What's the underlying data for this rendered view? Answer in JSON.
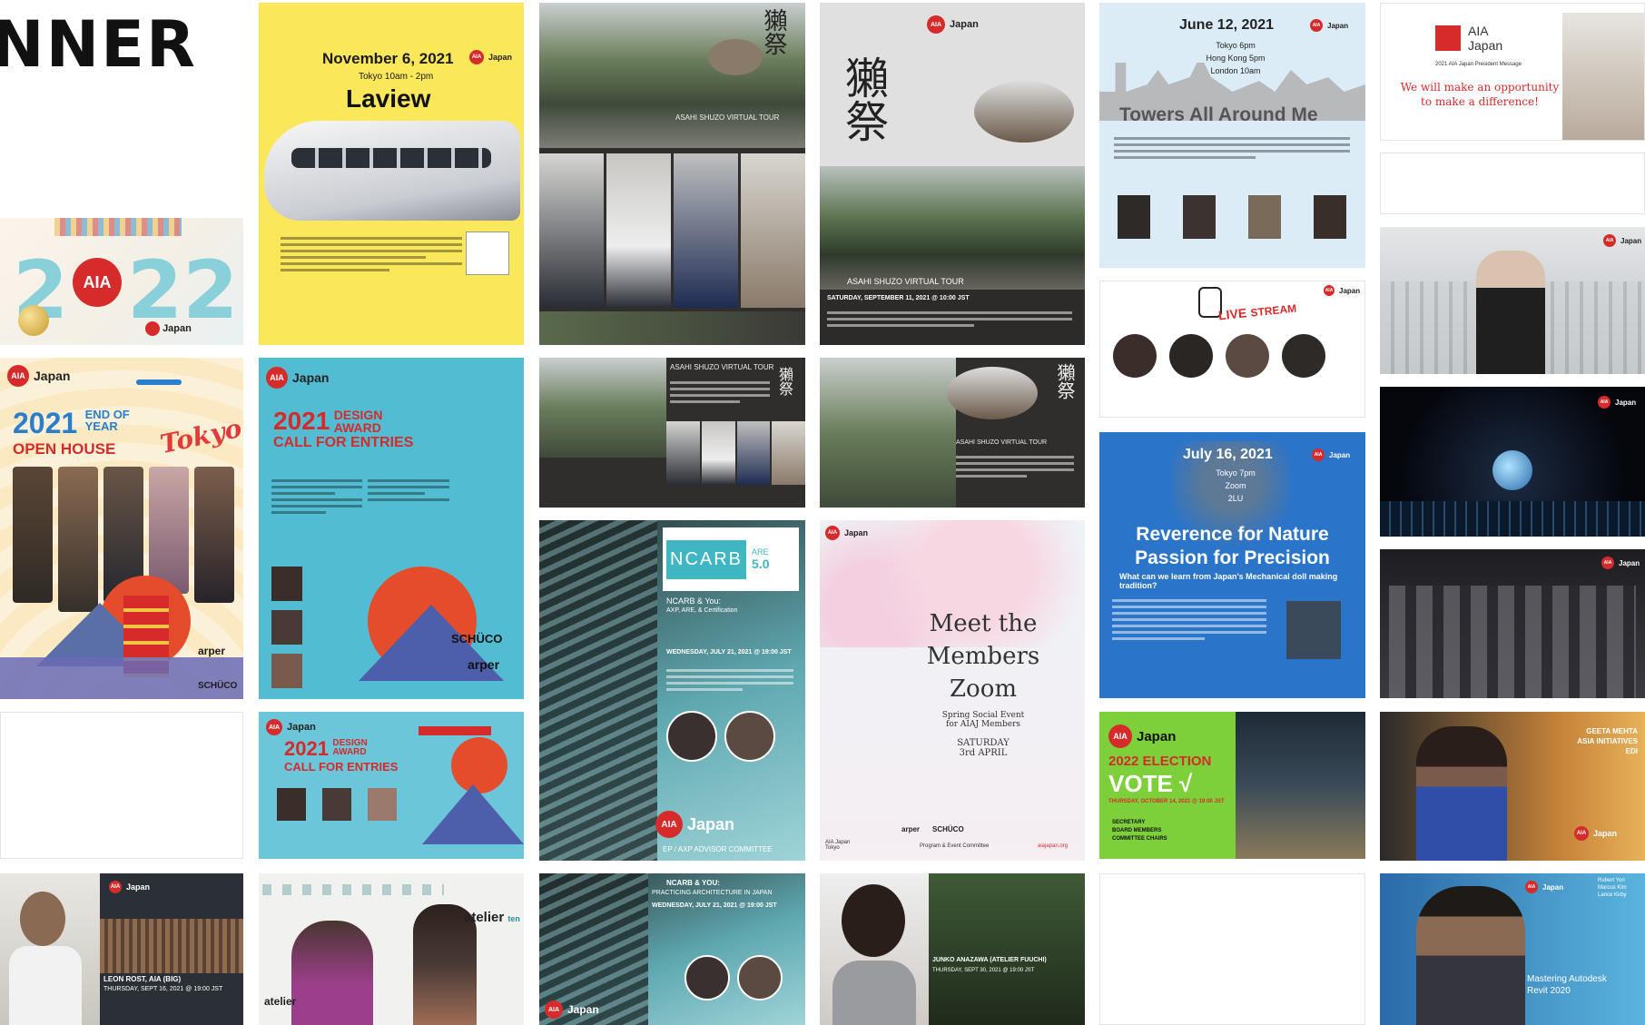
{
  "page": {
    "heading": "NNER"
  },
  "common": {
    "aia": "AIA",
    "japan": "Japan"
  },
  "laview": {
    "date": "November 6, 2021",
    "time": "Tokyo 10am - 2pm",
    "title": "Laview"
  },
  "newyear": {
    "numA": "2",
    "numB": "22"
  },
  "openhouse": {
    "year": "2021",
    "line1": "END OF",
    "line2": "YEAR",
    "line3": "OPEN HOUSE",
    "city": "Tokyo",
    "sponsor1": "SCHÜCO",
    "sponsor2": "arper"
  },
  "design1": {
    "year": "2021",
    "line1": "DESIGN",
    "line2": "AWARD",
    "line3": "CALL FOR ENTRIES",
    "s1": "SCHÜCO",
    "s2": "arper"
  },
  "design2": {
    "year": "2021",
    "line1": "DESIGN",
    "line2": "AWARD",
    "line3": "CALL FOR ENTRIES"
  },
  "dassai": {
    "tour": "ASAHI SHUZO VIRTUAL TOUR",
    "date": "SATURDAY, SEPTEMBER 11, 2021 @ 10:00 JST",
    "kanji": "獺祭"
  },
  "towers": {
    "date": "June 12, 2021",
    "t1": "Tokyo 6pm",
    "t2": "Hong Kong 5pm",
    "t3": "London 10am",
    "title": "Towers All Around Me"
  },
  "livestream": {
    "word1": "LIVE",
    "word2": "STREAM"
  },
  "president": {
    "brand1": "AIA",
    "brand2": "Japan",
    "caption": "2021 AIA Japan President Message",
    "msg1": "We will make an opportunity",
    "msg2": "to make a difference!"
  },
  "ncarb": {
    "logo": "NCARB",
    "are": "ARE",
    "version": "5.0",
    "sub": "NCARB & You:",
    "sub2": "AXP, ARE, & Certification",
    "date": "WEDNESDAY, JULY 21, 2021 @ 19:00 JST",
    "footer": "EP / AXP ADVISOR COMMITTEE"
  },
  "meet": {
    "l1": "Meet the",
    "l2": "Members",
    "l3": "Zoom",
    "sub1": "Spring Social Event",
    "sub2": "for AIAJ Members",
    "day": "SATURDAY",
    "date": "3rd APRIL",
    "foot1": "AIA Japan",
    "foot2": "Tokyo",
    "foot3": "Program & Event Committee",
    "foot4": "aiajapan.org",
    "sp1": "arper",
    "sp2": "SCHÜCO"
  },
  "reverence": {
    "date": "July 16, 2021",
    "t1": "Tokyo 7pm",
    "t2": "Zoom",
    "t3": "2LU",
    "title1": "Reverence for Nature",
    "title2": "Passion for Precision",
    "sub": "What can we learn from Japan's Mechanical doll making tradition?"
  },
  "election": {
    "title": "2022 ELECTION",
    "vote": "VOTE √",
    "date": "THURSDAY, OCTOBER 14, 2021 @ 19:00 JST",
    "items": [
      "SECRETARY",
      "BOARD MEMBERS",
      "COMMITTEE CHAIRS"
    ]
  },
  "geeta": {
    "name": "GEETA MEHTA",
    "line2": "ASIA INITIATIVES",
    "line3": "EDI"
  },
  "leon": {
    "name": "LEON ROST, AIA (BIG)",
    "date": "THURSDAY, SEPT 16, 2021 @ 19:00 JST"
  },
  "atelier": {
    "brand": "atelier",
    "brand2": "ten",
    "left": "atelier"
  },
  "junko": {
    "name": "JUNKO ANAZAWA (ATELIER FUUCHI)",
    "date": "THURSDAY, SEPT 30, 2021 @ 19:00 JST"
  },
  "revit": {
    "title1": "Mastering Autodesk",
    "title2": "Revit 2020",
    "names": "Robert Yori\nMarcus Kim\nLance Kirby"
  },
  "ncarb2": {
    "head": "NCARB & YOU:",
    "head2": "PRACTICING ARCHITECTURE IN JAPAN",
    "date": "WEDNESDAY, JULY 21, 2021 @ 19:00 JST"
  }
}
